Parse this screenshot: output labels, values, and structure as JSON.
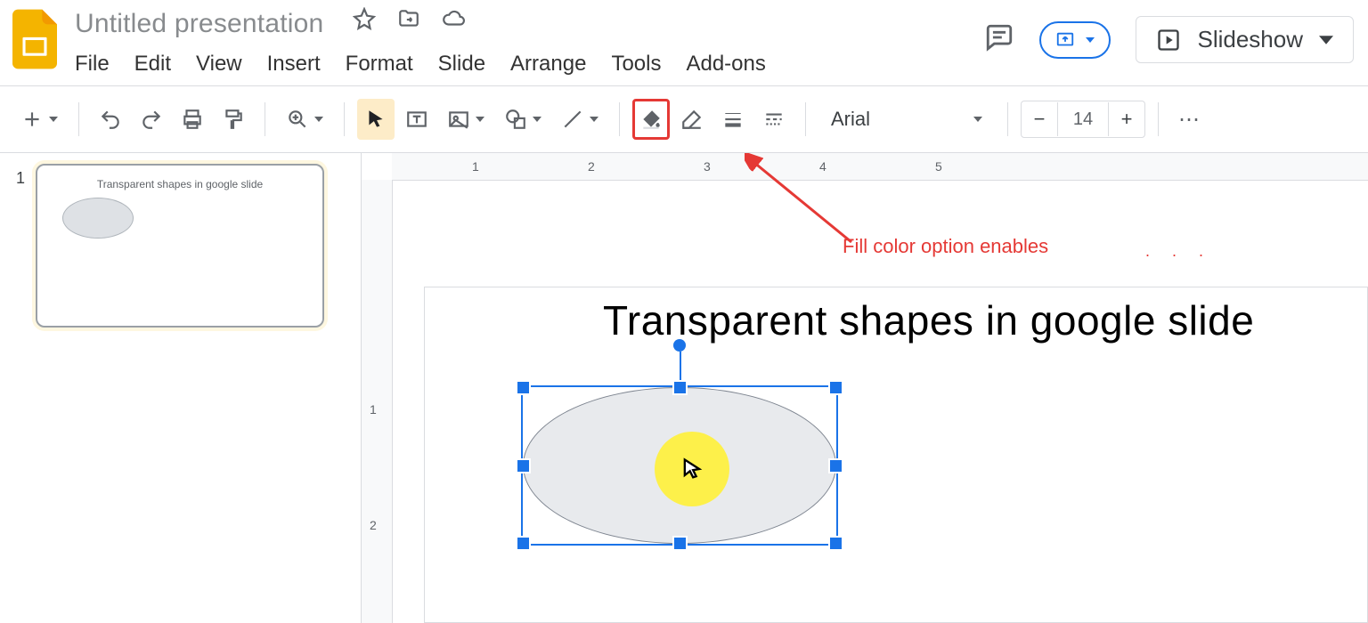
{
  "app": {
    "title": "Untitled presentation"
  },
  "menu": {
    "file": "File",
    "edit": "Edit",
    "view": "View",
    "insert": "Insert",
    "format": "Format",
    "slide": "Slide",
    "arrange": "Arrange",
    "tools": "Tools",
    "addons": "Add-ons"
  },
  "header_buttons": {
    "slideshow": "Slideshow"
  },
  "toolbar": {
    "font_name": "Arial",
    "font_size": "14"
  },
  "ruler": {
    "h": [
      "1",
      "2",
      "3",
      "4",
      "5"
    ],
    "v": [
      "1",
      "2"
    ]
  },
  "thumbnails": [
    {
      "number": "1",
      "title": "Transparent shapes in google slide"
    }
  ],
  "slide": {
    "heading": "Transparent shapes in google slide"
  },
  "annotation": {
    "label": "Fill color option enables",
    "dots": ". . ."
  }
}
